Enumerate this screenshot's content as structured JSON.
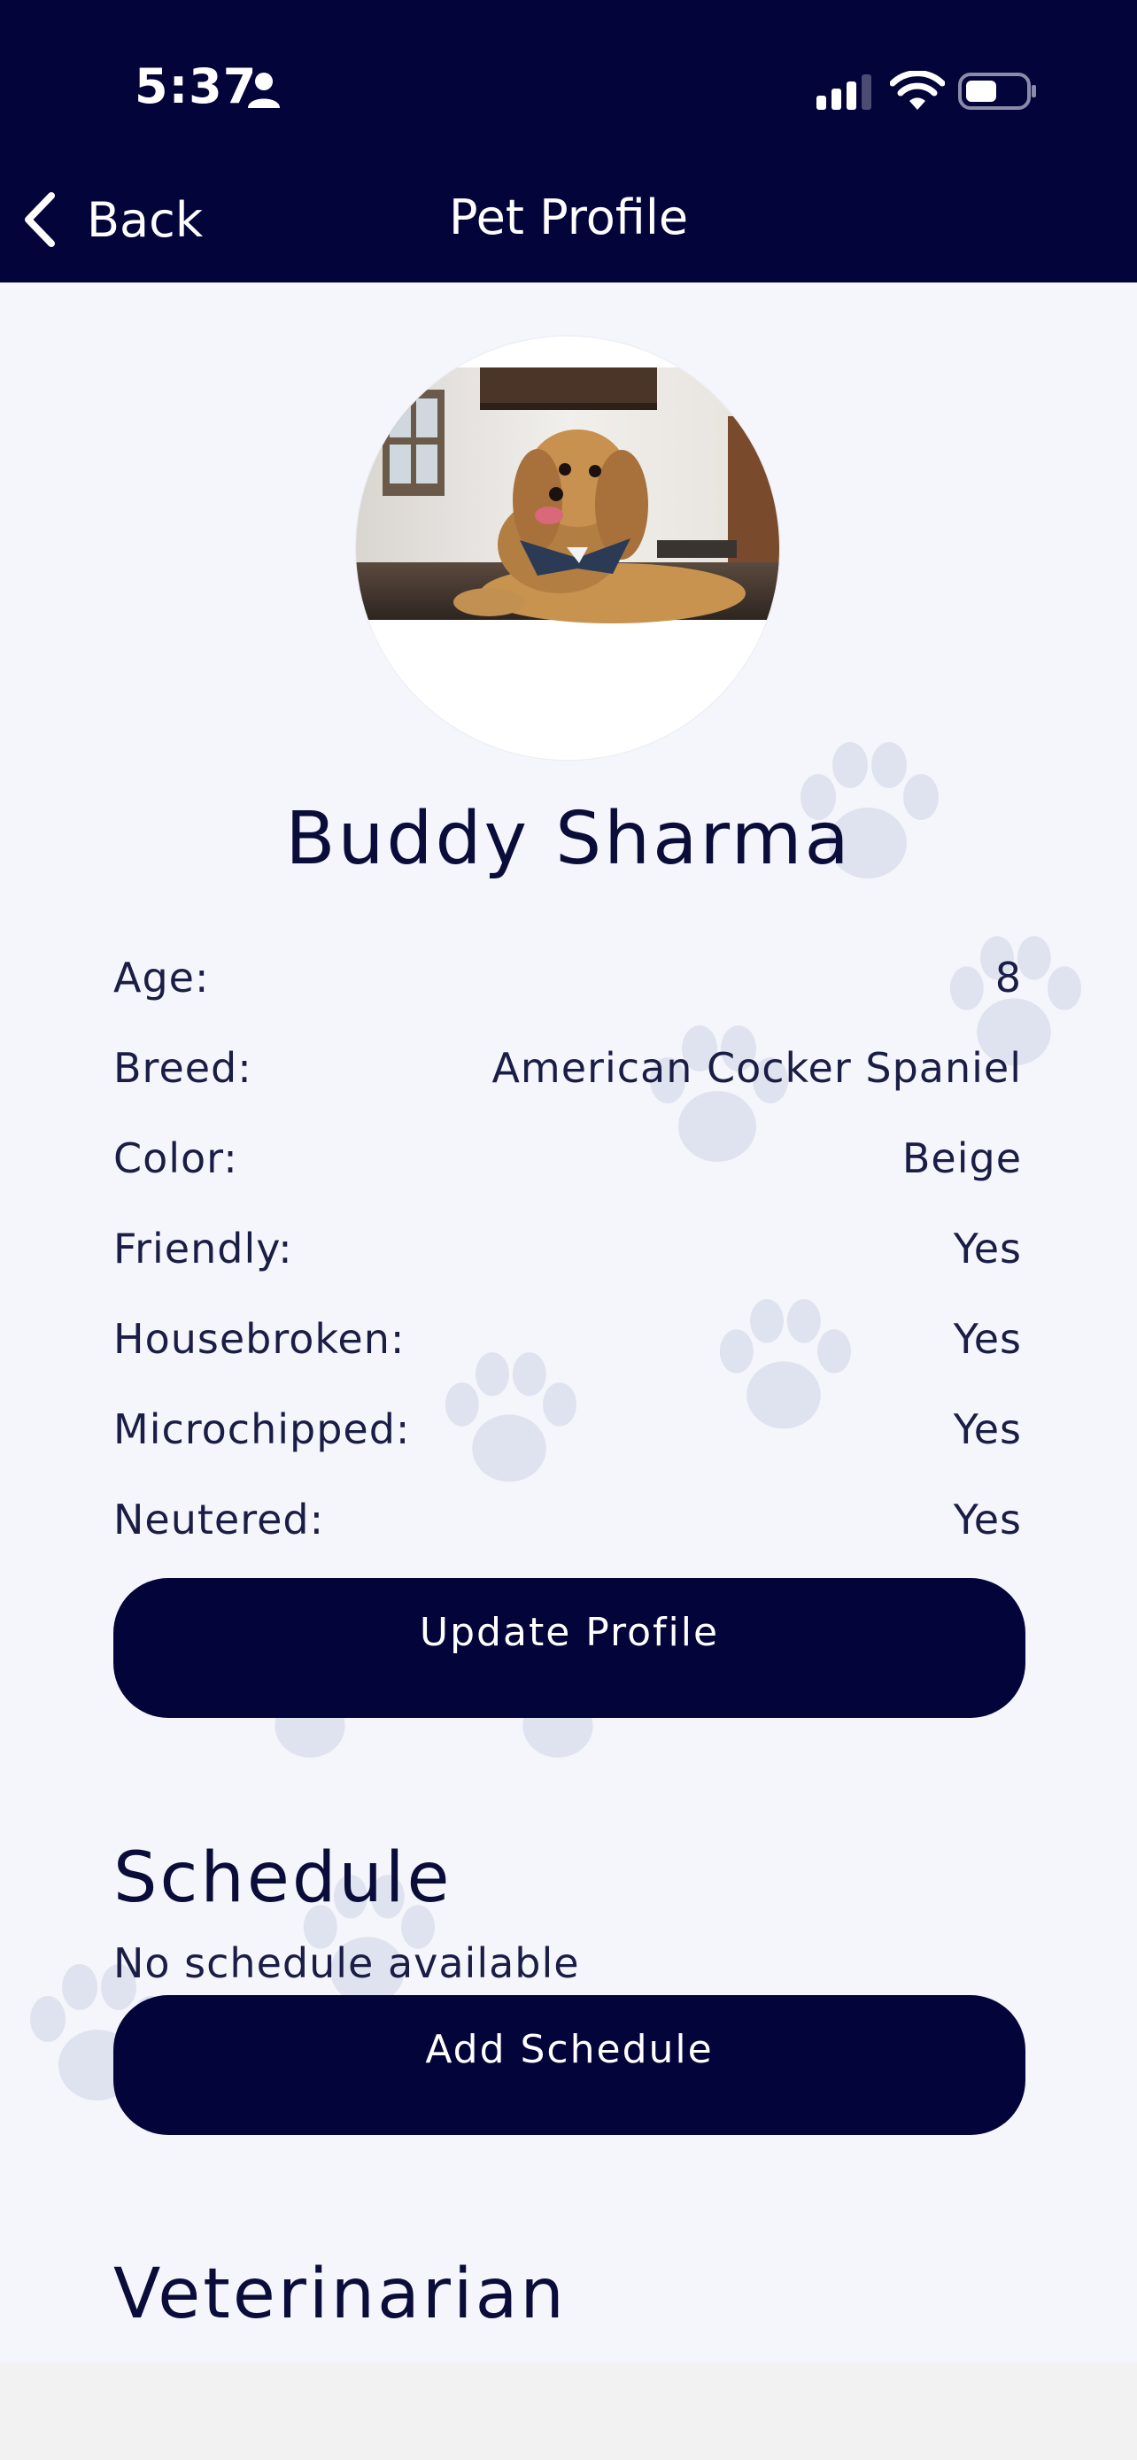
{
  "status_bar": {
    "time": "5:37"
  },
  "nav": {
    "back_label": "Back",
    "title": "Pet Profile"
  },
  "pet": {
    "name": "Buddy Sharma",
    "details": [
      {
        "label": "Age:",
        "value": "8"
      },
      {
        "label": "Breed:",
        "value": "American Cocker Spaniel"
      },
      {
        "label": "Color:",
        "value": "Beige"
      },
      {
        "label": "Friendly:",
        "value": "Yes"
      },
      {
        "label": "Housebroken:",
        "value": "Yes"
      },
      {
        "label": "Microchipped:",
        "value": "Yes"
      },
      {
        "label": "Neutered:",
        "value": "Yes"
      }
    ]
  },
  "actions": {
    "update_profile": "Update Profile",
    "add_schedule": "Add Schedule"
  },
  "schedule": {
    "title": "Schedule",
    "empty_text": "No schedule available"
  },
  "veterinarian": {
    "title": "Veterinarian"
  },
  "colors": {
    "header_bg": "#03043a",
    "page_bg": "#f5f6fb",
    "button_bg": "#03043a",
    "paw_watermark": "#dfe3ef"
  },
  "icons": {
    "back": "chevron-left-icon",
    "person": "person-icon",
    "signal": "cellular-signal-icon",
    "wifi": "wifi-icon",
    "battery": "battery-icon",
    "paw": "paw-print-icon"
  }
}
